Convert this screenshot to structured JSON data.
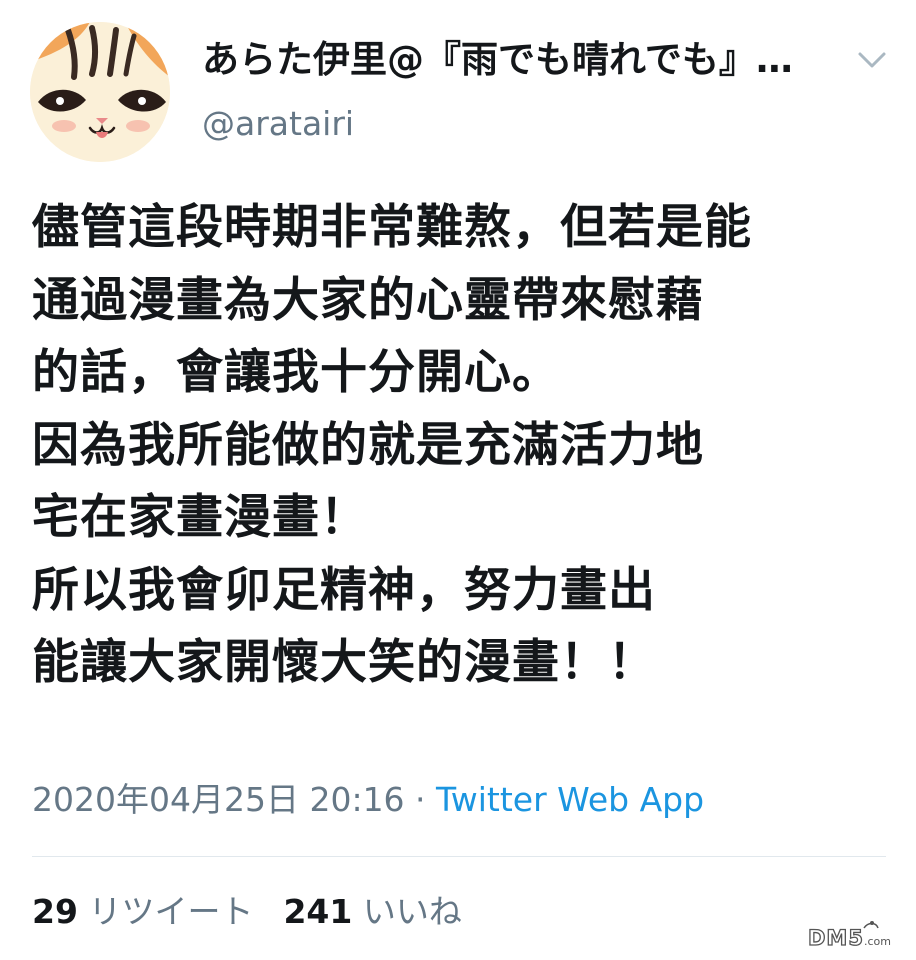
{
  "user": {
    "display_name": "あらた伊里@『雨でも晴れでも』…",
    "handle": "@aratairi"
  },
  "icons": {
    "avatar": "cat-face-avatar",
    "menu": "chevron-down-icon"
  },
  "tweet": {
    "text": "儘管這段時期非常難熬，但若是能\n通過漫畫為大家的心靈帶來慰藉\n的話，會讓我十分開心。\n因為我所能做的就是充滿活力地\n宅在家畫漫畫！\n所以我會卯足精神，努力畫出\n能讓大家開懷大笑的漫畫！！",
    "timestamp": "2020年04月25日 20:16",
    "separator": " · ",
    "source": "Twitter Web App"
  },
  "stats": {
    "retweet_count": "29",
    "retweet_label": "リツイート",
    "like_count": "241",
    "like_label": "いいね"
  },
  "watermark": {
    "text": "DM5.com"
  },
  "colors": {
    "text_primary": "#14171a",
    "text_secondary": "#657786",
    "link": "#1b95e0",
    "divider": "#e1e8ed"
  }
}
